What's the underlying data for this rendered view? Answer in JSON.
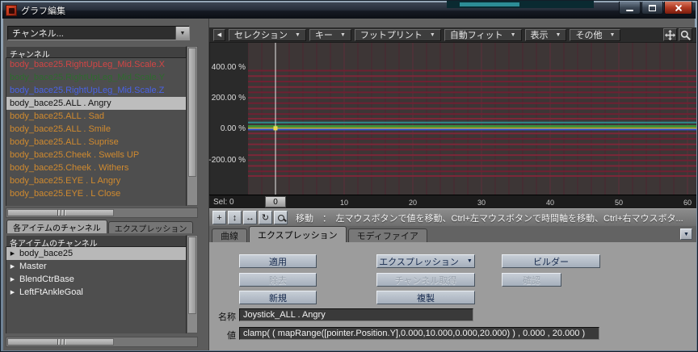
{
  "window": {
    "title": "グラフ編集"
  },
  "icons": {
    "chevron_down": "▼",
    "back_arrow": "◀",
    "tree_arrow": "▶"
  },
  "left_panel": {
    "channel_dropdown_label": "チャンネル...",
    "channel_header": "チャンネル",
    "channels": [
      {
        "label": "body_bace25.RightUpLeg_Mid.Scale.X",
        "color": "#d34545",
        "selected": false
      },
      {
        "label": "body_bace25.RightUpLeg_Mid.Scale.Y",
        "color": "#2e6b2e",
        "selected": false
      },
      {
        "label": "body_bace25.RightUpLeg_Mid.Scale.Z",
        "color": "#4a63e6",
        "selected": false
      },
      {
        "label": "body_bace25.ALL . Angry",
        "color": "#111111",
        "selected": true
      },
      {
        "label": "body_bace25.ALL . Sad",
        "color": "#d08a2f",
        "selected": false
      },
      {
        "label": "body_bace25.ALL . Smile",
        "color": "#d08a2f",
        "selected": false
      },
      {
        "label": "body_bace25.ALL . Suprise",
        "color": "#d08a2f",
        "selected": false
      },
      {
        "label": "body_bace25.Cheek . Swells UP",
        "color": "#d08a2f",
        "selected": false
      },
      {
        "label": "body_bace25.Cheek . Withers",
        "color": "#d08a2f",
        "selected": false
      },
      {
        "label": "body_bace25.EYE . L Angry",
        "color": "#d08a2f",
        "selected": false
      },
      {
        "label": "body_bace25.EYE . L Close",
        "color": "#d08a2f",
        "selected": false
      }
    ],
    "tabs": [
      {
        "id": "item-channels",
        "label": "各アイテムのチャンネル",
        "active": true
      },
      {
        "id": "expression-list",
        "label": "エクスプレッション",
        "active": false
      }
    ],
    "item_header": "各アイテムのチャンネル",
    "items": [
      {
        "label": "body_bace25",
        "selected": true
      },
      {
        "label": "Master",
        "selected": false
      },
      {
        "label": "BlendCtrBase",
        "selected": false
      },
      {
        "label": "LeftFtAnkleGoal",
        "selected": false
      }
    ]
  },
  "toolbar": {
    "menus": [
      {
        "id": "selection",
        "label": "セレクション"
      },
      {
        "id": "key",
        "label": "キー"
      },
      {
        "id": "footprint",
        "label": "フットプリント"
      },
      {
        "id": "autofit",
        "label": "自動フィット"
      },
      {
        "id": "view",
        "label": "表示"
      },
      {
        "id": "other",
        "label": "その他"
      }
    ]
  },
  "graph": {
    "sel_label": "Sel: 0",
    "xlim": [
      -4,
      61.3
    ],
    "ylim": [
      -420,
      560
    ],
    "x_ticks": [
      0,
      10,
      20,
      30,
      40,
      50,
      60
    ],
    "current_frame": 0,
    "playhead_color": "#e9e9e9",
    "bg": "#3d3636",
    "grid": {
      "minor": "#4a2630",
      "major": "#5d2e3a"
    },
    "y_labels": [
      {
        "value": 400,
        "label": "400.00 %"
      },
      {
        "value": 200,
        "label": "200.00 %"
      },
      {
        "value": 0,
        "label": "0.00 %"
      },
      {
        "value": -200,
        "label": "-200.00 %"
      }
    ],
    "key": {
      "frame": 0,
      "value": 8,
      "color": "#ead94e"
    },
    "curves": [
      {
        "value": 380,
        "color": "#6e2132"
      },
      {
        "value": 345,
        "color": "#7c2738"
      },
      {
        "value": 310,
        "color": "#6e2132"
      },
      {
        "value": 275,
        "color": "#7c2738"
      },
      {
        "value": 240,
        "color": "#6e2132"
      },
      {
        "value": 205,
        "color": "#7c2738"
      },
      {
        "value": 170,
        "color": "#6e2132"
      },
      {
        "value": 135,
        "color": "#7c2738"
      },
      {
        "value": 100,
        "color": "#6e2132"
      },
      {
        "value": 70,
        "color": "#7c2738"
      },
      {
        "value": 45,
        "color": "#2e8b8b"
      },
      {
        "value": 22,
        "color": "#3aa33a"
      },
      {
        "value": 8,
        "color": "#c8c32f"
      },
      {
        "value": 0,
        "color": "#3350d4"
      },
      {
        "value": -25,
        "color": "#7c2738"
      },
      {
        "value": -60,
        "color": "#6e2132"
      },
      {
        "value": -95,
        "color": "#7c2738"
      },
      {
        "value": -130,
        "color": "#6e2132"
      },
      {
        "value": -165,
        "color": "#7c2738"
      },
      {
        "value": -200,
        "color": "#6e2132"
      },
      {
        "value": -235,
        "color": "#7c2738"
      },
      {
        "value": -270,
        "color": "#6e2132"
      },
      {
        "value": -300,
        "color": "#7c2738"
      }
    ]
  },
  "status": {
    "text": "移動　：　左マウスボタンで値を移動、Ctrl+左マウスボタンで時間軸を移動、Ctrl+右マウスボタ...",
    "buttons": [
      {
        "id": "move-keys",
        "glyph": "+"
      },
      {
        "id": "move-vertical",
        "glyph": "↕"
      },
      {
        "id": "move-horizontal",
        "glyph": "↔"
      },
      {
        "id": "cycle",
        "glyph": "↻"
      },
      {
        "id": "region-zoom",
        "icon": "magnifier",
        "glyph": ""
      }
    ]
  },
  "bottom_tabs": [
    {
      "id": "curve",
      "label": "曲線",
      "active": false
    },
    {
      "id": "expression",
      "label": "エクスプレッション",
      "active": true
    },
    {
      "id": "modifier",
      "label": "モディファイア",
      "active": false
    }
  ],
  "expression_panel": {
    "buttons": [
      {
        "id": "apply",
        "label": "適用",
        "enabled": true,
        "col": 0,
        "row": 0
      },
      {
        "id": "expression-menu",
        "label": "エクスプレッション",
        "enabled": true,
        "col": 1,
        "row": 0,
        "dropdown": true
      },
      {
        "id": "builder",
        "label": "ビルダー",
        "enabled": true,
        "col": 2,
        "row": 0
      },
      {
        "id": "remove",
        "label": "除去",
        "enabled": false,
        "col": 0,
        "row": 1
      },
      {
        "id": "get-channel",
        "label": "チャンネル取得",
        "enabled": false,
        "col": 1,
        "row": 1
      },
      {
        "id": "confirm",
        "label": "確認",
        "enabled": false,
        "col": 2,
        "row": 1,
        "width": 74
      },
      {
        "id": "new",
        "label": "新規",
        "enabled": true,
        "col": 0,
        "row": 2
      },
      {
        "id": "duplicate",
        "label": "複製",
        "enabled": true,
        "col": 1,
        "row": 2
      }
    ],
    "name_label": "名称",
    "name_value": "Joystick_ALL . Angry",
    "value_label": "値",
    "value_value": "clamp( ( mapRange([pointer.Position.Y],0.000,10.000,0.000,20.000) ) , 0.000 , 20.000 )"
  }
}
